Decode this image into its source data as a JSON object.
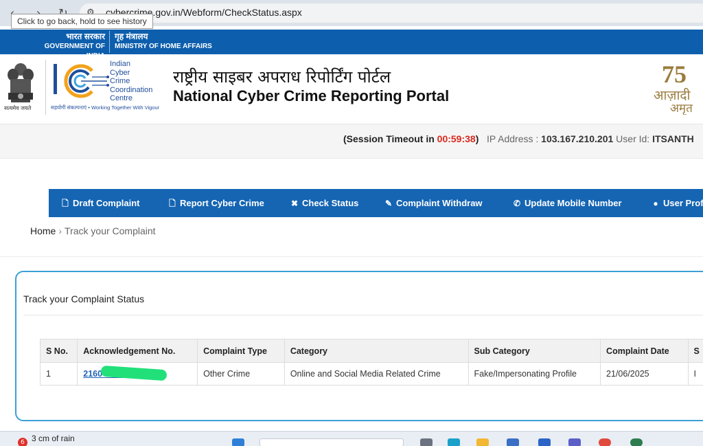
{
  "browser": {
    "url": "cybercrime.gov.in/Webform/CheckStatus.aspx",
    "tooltip": "Click to go back, hold to see history"
  },
  "gov_strip": {
    "gov_hi": "भारत सरकार",
    "gov_en": "GOVERNMENT OF INDIA",
    "ministry_hi": "गृह मंत्रालय",
    "ministry_en": "MINISTRY OF HOME AFFAIRS"
  },
  "header": {
    "emblem_caption": "सत्यमेव जयते",
    "i4c_lines": [
      "Indian",
      "Cyber",
      "Crime",
      "Coordination",
      "Centre"
    ],
    "i4c_tagline": "सहयोगी संकल्पनाएं  •  Working Together With Vigour",
    "portal_title_hi": "राष्ट्रीय साइबर अपराध रिपोर्टिंग पोर्टल",
    "portal_title_en": "National Cyber Crime Reporting Portal",
    "azadi_number": "75",
    "azadi_text_1": "आज़ादी",
    "azadi_text_2": "अमृत"
  },
  "session": {
    "timeout_label": "(Session Timeout in",
    "timeout_value": "00:59:38",
    "timeout_close": ")",
    "ip_label": "IP Address :",
    "ip_value": "103.167.210.201",
    "user_label": "User Id:",
    "user_value": "ITSANTH"
  },
  "menu": {
    "items": [
      {
        "label": "Draft Complaint",
        "icon": "document-icon"
      },
      {
        "label": "Report Cyber Crime",
        "icon": "document-icon"
      },
      {
        "label": "Check Status",
        "icon": "close-icon"
      },
      {
        "label": "Complaint Withdraw",
        "icon": "edit-icon"
      },
      {
        "label": "Update Mobile Number",
        "icon": "phone-icon"
      },
      {
        "label": "User Prof",
        "icon": "user-icon"
      }
    ]
  },
  "breadcrumb": {
    "home": "Home",
    "separator": "›",
    "current": "Track your Complaint"
  },
  "panel": {
    "title": "Track your Complaint Status"
  },
  "table": {
    "headers": [
      "S No.",
      "Acknowledgement No.",
      "Complaint Type",
      "Category",
      "Sub Category",
      "Complaint Date",
      "S"
    ],
    "rows": [
      [
        "1",
        "2160",
        "Other Crime",
        "Online and Social Media Related Crime",
        "Fake/Impersonating Profile",
        "21/06/2025",
        "I"
      ]
    ]
  },
  "taskbar": {
    "notification_count": "6",
    "weather_text": "3 cm of rain"
  },
  "colors": {
    "primary_blue": "#1565b3",
    "gov_strip_blue": "#0d5fad",
    "timeout_red": "#d9281d",
    "panel_border": "#3aa0d6",
    "redaction_green": "#21e07a"
  }
}
